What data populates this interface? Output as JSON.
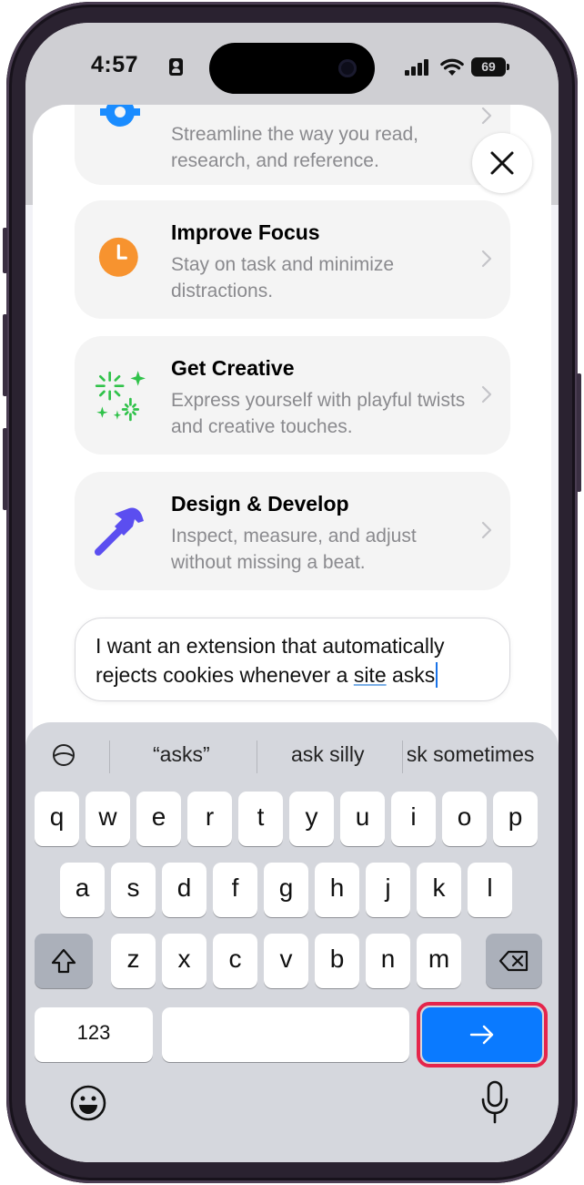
{
  "status_bar": {
    "time": "4:57",
    "battery": "69"
  },
  "cards": [
    {
      "name": "partial",
      "desc": "Streamline the way you read, research, and reference.",
      "icon": "gear-icon"
    },
    {
      "name": "improve-focus",
      "title": "Improve Focus",
      "desc": "Stay on task and minimize distractions.",
      "icon": "clock-icon",
      "icon_color": "#f7932f"
    },
    {
      "name": "get-creative",
      "title": "Get Creative",
      "desc": "Express yourself with playful twists and creative touches.",
      "icon": "sparkles-icon",
      "icon_color": "#30c24a"
    },
    {
      "name": "design-develop",
      "title": "Design & Develop",
      "desc": "Inspect, measure, and adjust without missing a beat.",
      "icon": "hammer-icon",
      "icon_color": "#5b4ef0"
    }
  ],
  "prompt_input": {
    "text_before": "I want an extension that automatically rejects cookies whenever a ",
    "underlined": "site",
    "text_after": " asks"
  },
  "keyboard": {
    "suggestions": [
      "“asks”",
      "ask silly",
      "ask sometimes"
    ],
    "row1": [
      "q",
      "w",
      "e",
      "r",
      "t",
      "y",
      "u",
      "i",
      "o",
      "p"
    ],
    "row2": [
      "a",
      "s",
      "d",
      "f",
      "g",
      "h",
      "j",
      "k",
      "l"
    ],
    "row3": [
      "z",
      "x",
      "c",
      "v",
      "b",
      "n",
      "m"
    ],
    "numbers_label": "123",
    "go_color": "#0a7aff",
    "highlight_color": "#e5254b"
  }
}
